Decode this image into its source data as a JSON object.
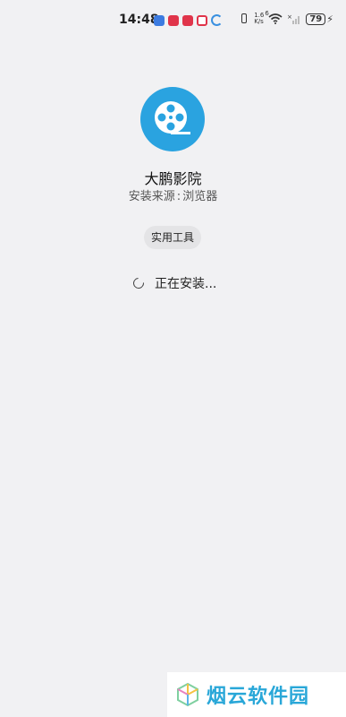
{
  "status_bar": {
    "time": "14:48",
    "net_speed_value": "1.6",
    "net_speed_unit": "K/s",
    "wifi_label": "6",
    "battery": "79",
    "notification_colors": [
      "#3c7be0",
      "#e0344a",
      "#e0344a",
      "#e0344a"
    ]
  },
  "app": {
    "name": "大鹏影院",
    "source_label": "安装来源",
    "source_sep": ":",
    "source_value": "浏览器",
    "category": "实用工具",
    "icon": "film-reel-icon",
    "icon_color": "#2aa3e0"
  },
  "install": {
    "status": "正在安装..."
  },
  "watermark": {
    "text": "烟云软件园"
  }
}
